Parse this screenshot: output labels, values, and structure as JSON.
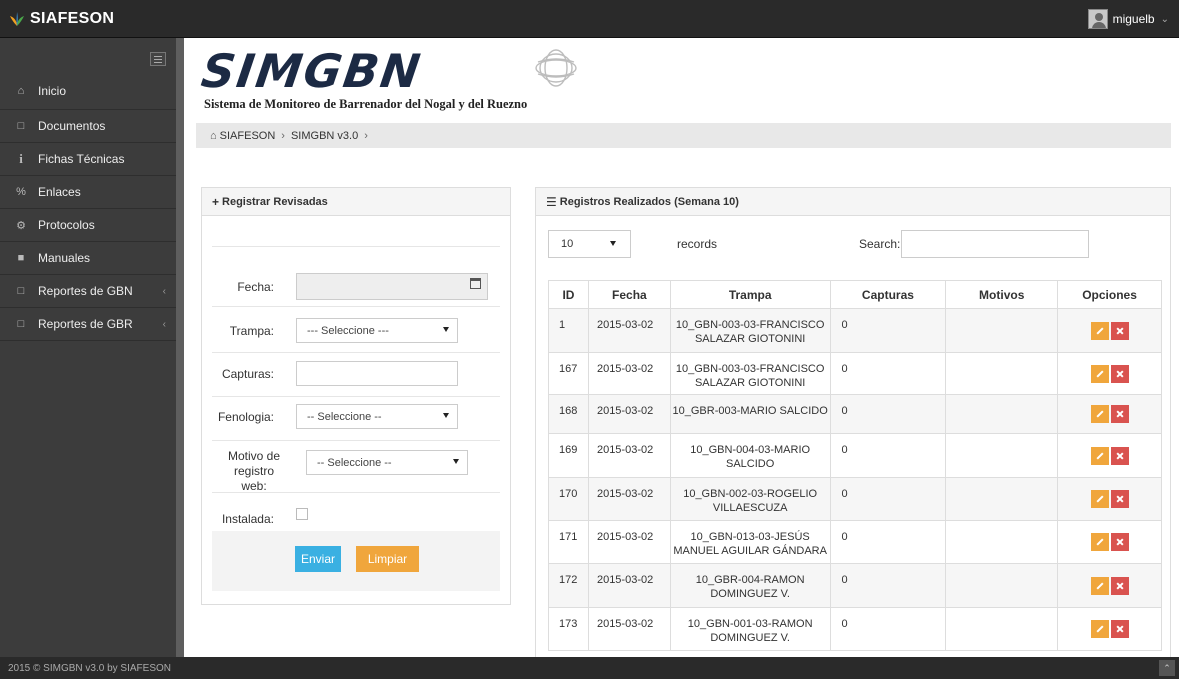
{
  "topbar": {
    "brand": "SIAFESON",
    "brand_icon": "siafeson-leaf-icon",
    "username": "miguelb"
  },
  "sidebar": {
    "items": [
      {
        "label": "Inicio",
        "icon": "home-icon"
      },
      {
        "label": "Documentos",
        "icon": "folder-icon"
      },
      {
        "label": "Fichas Técnicas",
        "icon": "info-icon"
      },
      {
        "label": "Enlaces",
        "icon": "link-icon"
      },
      {
        "label": "Protocolos",
        "icon": "gear-icon"
      },
      {
        "label": "Manuales",
        "icon": "book-icon"
      },
      {
        "label": "Reportes de GBN",
        "icon": "file-icon",
        "expandable": true
      },
      {
        "label": "Reportes de GBR",
        "icon": "file-icon",
        "expandable": true
      }
    ]
  },
  "logo": {
    "title": "SIMGBN",
    "subtitle": "Sistema de Monitoreo de Barrenador del Nogal y del Ruezno"
  },
  "breadcrumb": {
    "items": [
      "SIAFESON",
      "SIMGBN v3.0"
    ]
  },
  "form": {
    "title": "Registrar Revisadas",
    "fecha_label": "Fecha:",
    "fecha_value": "",
    "trampa_label": "Trampa:",
    "trampa_value": "--- Seleccione ---",
    "capturas_label": "Capturas:",
    "capturas_value": "",
    "fenologia_label": "Fenologia:",
    "fenologia_value": "-- Seleccione --",
    "motivo_label_1": "Motivo de",
    "motivo_label_2": "registro web:",
    "motivo_value": "-- Seleccione --",
    "instalada_label": "Instalada:",
    "instalada_checked": false,
    "send_label": "Enviar",
    "clear_label": "Limpiar"
  },
  "records": {
    "title": "Registros Realizados (Semana 10)",
    "page_size": "10",
    "page_size_label": "records",
    "search_label": "Search:",
    "search_value": "",
    "columns": [
      "ID",
      "Fecha",
      "Trampa",
      "Capturas",
      "Motivos",
      "Opciones"
    ],
    "rows": [
      {
        "id": "1",
        "fecha": "2015-03-02",
        "trampa_1": "10_GBN-003-03-FRANCISCO",
        "trampa_2": "SALAZAR GIOTONINI",
        "capturas": "0",
        "motivos": ""
      },
      {
        "id": "167",
        "fecha": "2015-03-02",
        "trampa_1": "10_GBN-003-03-FRANCISCO",
        "trampa_2": "SALAZAR GIOTONINI",
        "capturas": "0",
        "motivos": ""
      },
      {
        "id": "168",
        "fecha": "2015-03-02",
        "trampa_1": "10_GBR-003-MARIO SALCIDO",
        "trampa_2": "",
        "capturas": "0",
        "motivos": ""
      },
      {
        "id": "169",
        "fecha": "2015-03-02",
        "trampa_1": "10_GBN-004-03-MARIO",
        "trampa_2": "SALCIDO",
        "capturas": "0",
        "motivos": ""
      },
      {
        "id": "170",
        "fecha": "2015-03-02",
        "trampa_1": "10_GBN-002-03-ROGELIO",
        "trampa_2": "VILLAESCUZA",
        "capturas": "0",
        "motivos": ""
      },
      {
        "id": "171",
        "fecha": "2015-03-02",
        "trampa_1": "10_GBN-013-03-JESÚS",
        "trampa_2": "MANUEL AGUILAR GÁNDARA",
        "capturas": "0",
        "motivos": ""
      },
      {
        "id": "172",
        "fecha": "2015-03-02",
        "trampa_1": "10_GBR-004-RAMON",
        "trampa_2": "DOMINGUEZ V.",
        "capturas": "0",
        "motivos": ""
      },
      {
        "id": "173",
        "fecha": "2015-03-02",
        "trampa_1": "10_GBN-001-03-RAMON",
        "trampa_2": "DOMINGUEZ V.",
        "capturas": "0",
        "motivos": ""
      }
    ]
  },
  "footer": {
    "text": "2015 © SIMGBN v3.0 by SIAFESON"
  }
}
